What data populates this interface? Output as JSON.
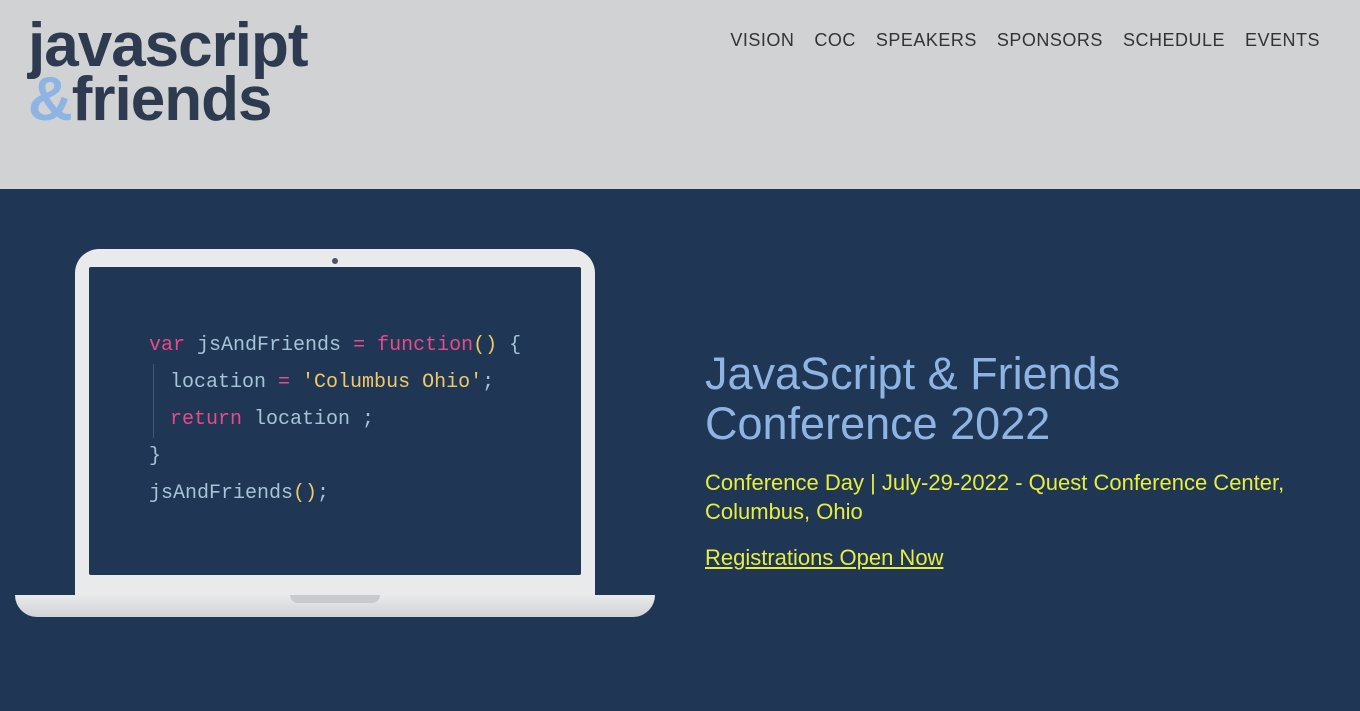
{
  "logo": {
    "line1": "javascript",
    "amp": "&",
    "line2_rest": "friends"
  },
  "nav": [
    {
      "label": "VISION"
    },
    {
      "label": "COC"
    },
    {
      "label": "SPEAKERS"
    },
    {
      "label": "SPONSORS"
    },
    {
      "label": "SCHEDULE"
    },
    {
      "label": "EVENTS"
    }
  ],
  "code": {
    "kw_var": "var",
    "fn_name": "jsAndFriends",
    "eq": "=",
    "kw_func": "function",
    "parens": "()",
    "brace_open": "{",
    "loc_assign_left": "location ",
    "loc_assign_eq": "=",
    "loc_str": " 'Columbus Ohio'",
    "semi": ";",
    "kw_ret": "return",
    "loc_ident": " location ",
    "brace_close": "}",
    "call": "jsAndFriends",
    "call_parens": "()",
    "call_semi": ";"
  },
  "hero": {
    "title": "JavaScript & Friends Conference 2022",
    "subtitle": "Conference Day |  July-29-2022 - Quest Conference Center, Columbus, Ohio",
    "registration": "Registrations Open Now"
  }
}
